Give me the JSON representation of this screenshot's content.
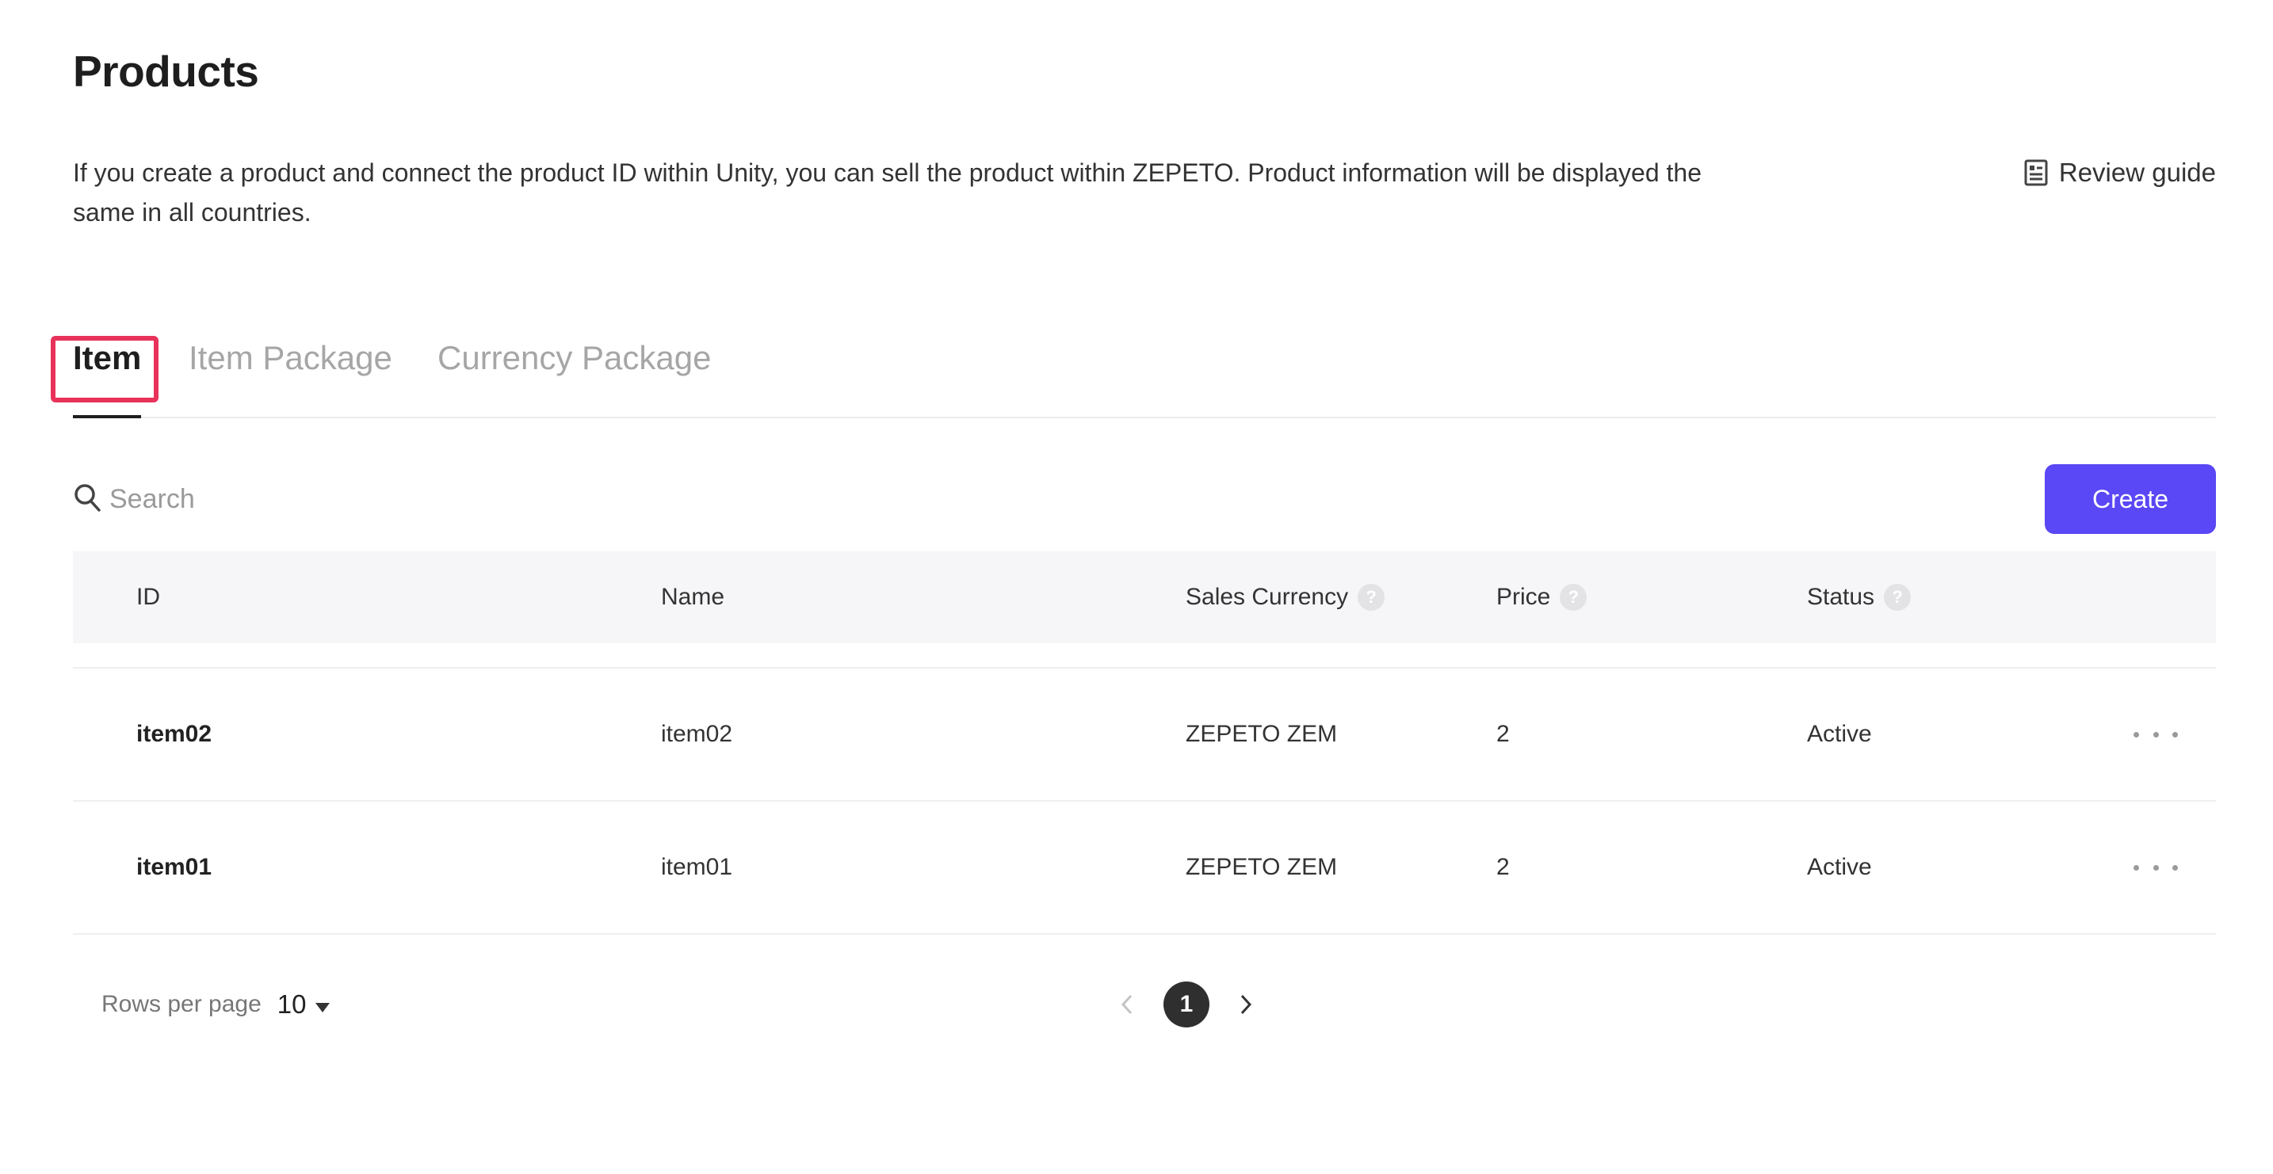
{
  "header": {
    "title": "Products",
    "description": "If you create a product and connect the product ID within Unity, you can sell the product within ZEPETO. Product information will be displayed the same in all countries.",
    "review_guide_label": "Review guide"
  },
  "tabs": [
    {
      "label": "Item",
      "active": true
    },
    {
      "label": "Item Package",
      "active": false
    },
    {
      "label": "Currency Package",
      "active": false
    }
  ],
  "search": {
    "placeholder": "Search",
    "value": ""
  },
  "create_label": "Create",
  "table": {
    "columns": [
      {
        "label": "ID",
        "info": false
      },
      {
        "label": "Name",
        "info": false
      },
      {
        "label": "Sales Currency",
        "info": true
      },
      {
        "label": "Price",
        "info": true
      },
      {
        "label": "Status",
        "info": true
      }
    ],
    "info_glyph": "?",
    "rows": [
      {
        "id": "item02",
        "name": "item02",
        "currency": "ZEPETO ZEM",
        "price": "2",
        "status": "Active"
      },
      {
        "id": "item01",
        "name": "item01",
        "currency": "ZEPETO ZEM",
        "price": "2",
        "status": "Active"
      }
    ]
  },
  "pagination": {
    "rows_per_page_label": "Rows per page",
    "rows_per_page_value": "10",
    "current_page": "1"
  },
  "colors": {
    "accent": "#5a47f5",
    "highlight": "#e8325a"
  }
}
